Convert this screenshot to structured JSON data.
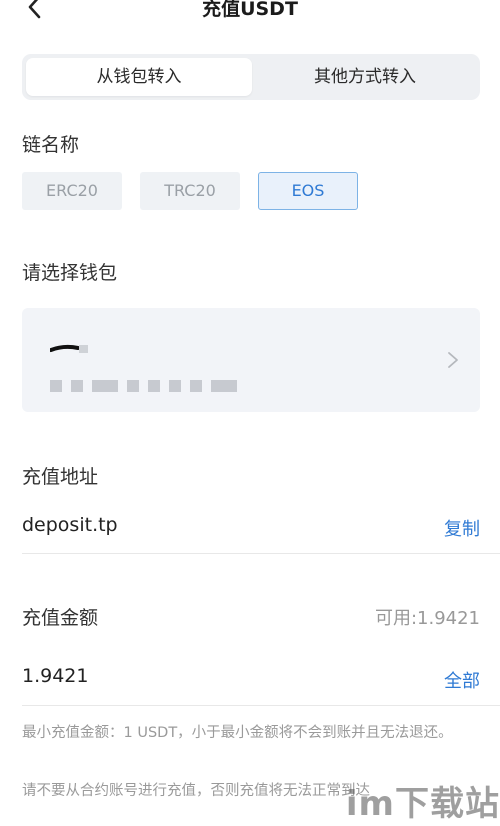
{
  "header": {
    "title": "充值USDT"
  },
  "tabs": [
    {
      "label": "从钱包转入",
      "active": true
    },
    {
      "label": "其他方式转入",
      "active": false
    }
  ],
  "chain": {
    "label": "链名称",
    "options": [
      "ERC20",
      "TRC20",
      "EOS"
    ],
    "selected": "EOS"
  },
  "wallet": {
    "label": "请选择钱包"
  },
  "deposit_address": {
    "label": "充值地址",
    "value": "deposit.tp",
    "copy_label": "复制"
  },
  "amount": {
    "label": "充值金额",
    "available": "可用:1.9421",
    "value": "1.9421",
    "all_label": "全部"
  },
  "notes": {
    "min_notice": "最小充值金额：1 USDT，小于最小金额将不会到账并且无法退还。",
    "contract_notice": "请不要从合约账号进行充值，否则充值将无法正常到达"
  },
  "watermark": "im下载站",
  "colors": {
    "accent": "#2f7ad4",
    "chip_bg": "#eff2f5",
    "card_bg": "#f2f4f8"
  }
}
